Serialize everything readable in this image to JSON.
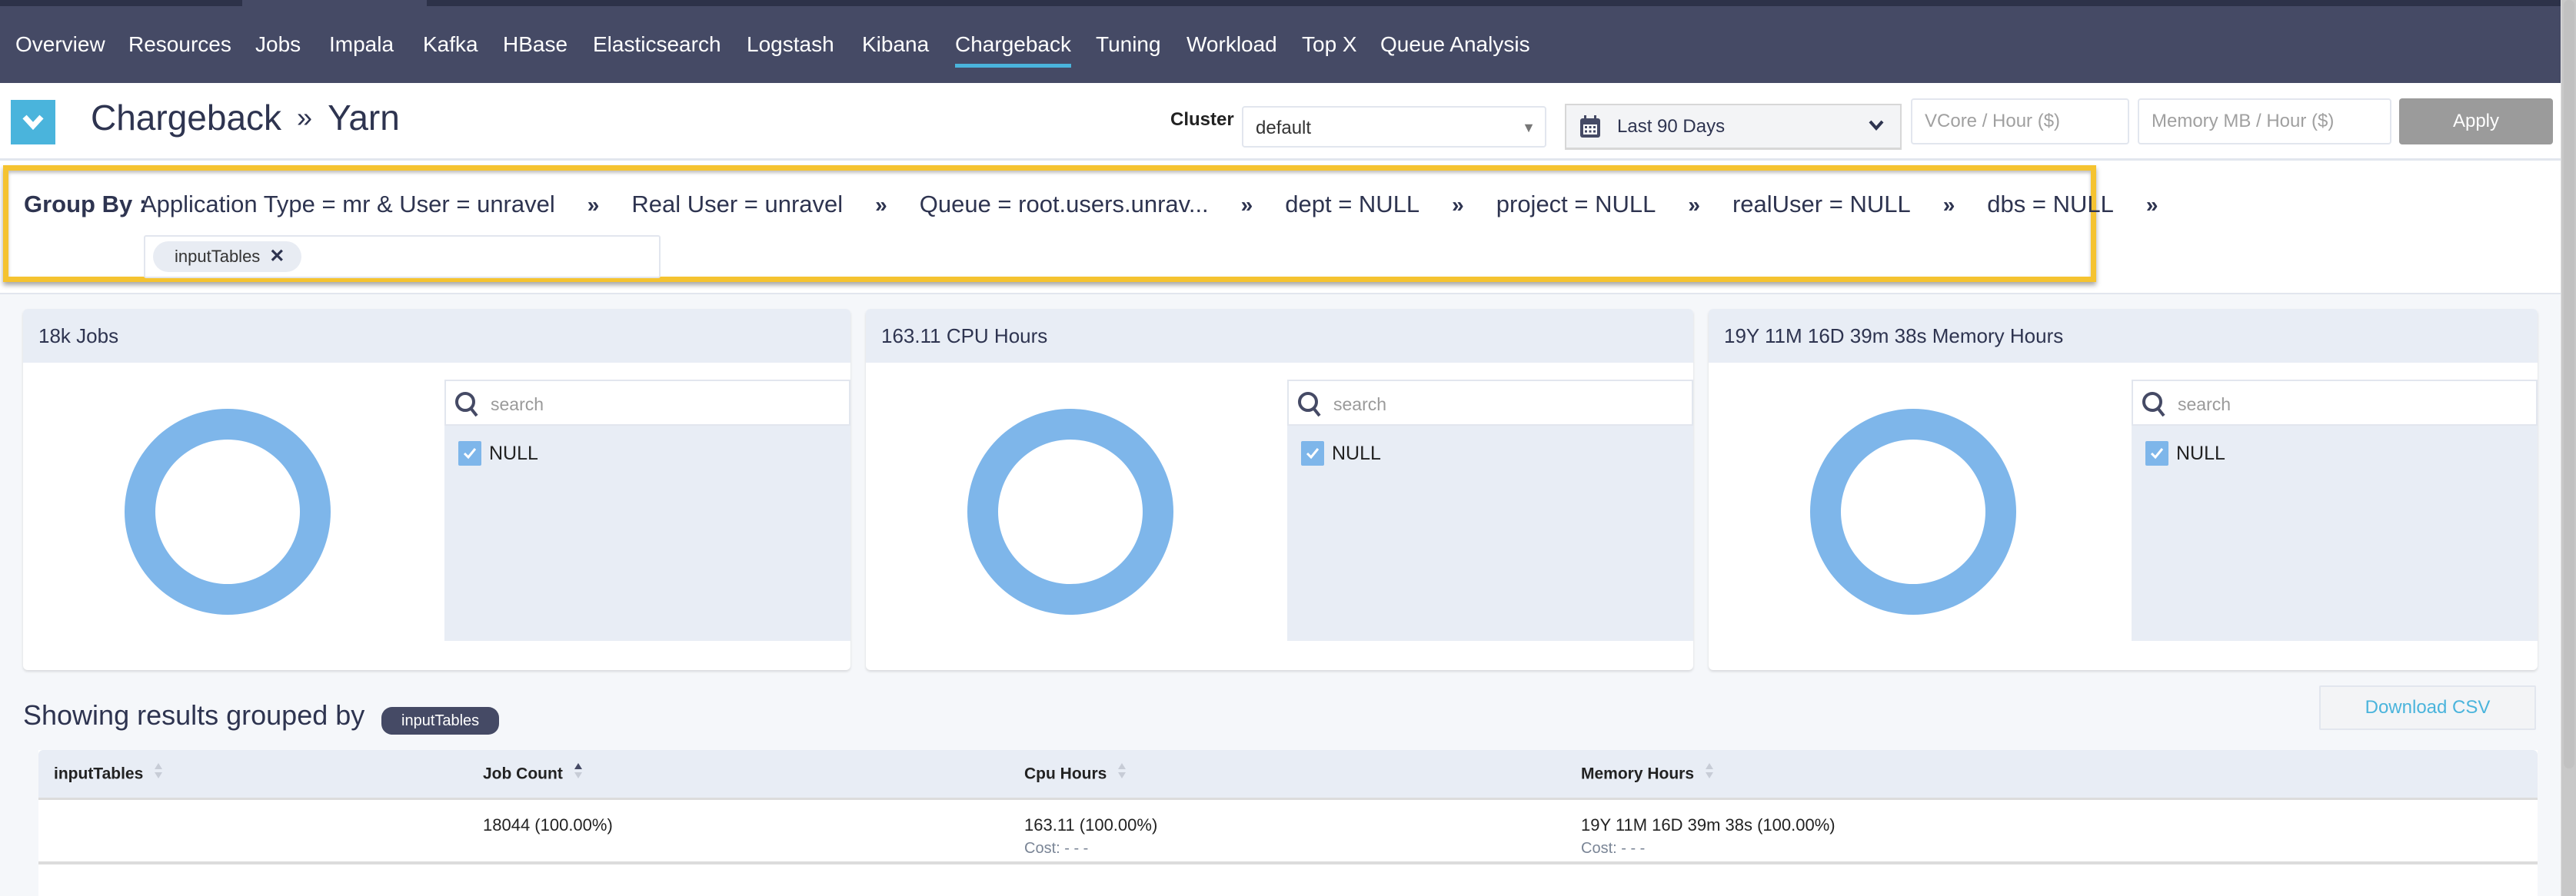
{
  "nav": {
    "items": [
      {
        "label": "Overview",
        "active": false
      },
      {
        "label": "Resources",
        "active": false
      },
      {
        "label": "Jobs",
        "active": false
      },
      {
        "label": "Impala",
        "active": false
      },
      {
        "label": "Kafka",
        "active": false
      },
      {
        "label": "HBase",
        "active": false
      },
      {
        "label": "Elasticsearch",
        "active": false
      },
      {
        "label": "Logstash",
        "active": false
      },
      {
        "label": "Kibana",
        "active": false
      },
      {
        "label": "Chargeback",
        "active": true
      },
      {
        "label": "Tuning",
        "active": false
      },
      {
        "label": "Workload",
        "active": false
      },
      {
        "label": "Top X",
        "active": false
      },
      {
        "label": "Queue Analysis",
        "active": false
      }
    ]
  },
  "header": {
    "logo_icon": "chevron-down-icon",
    "title_part1": "Chargeback",
    "title_sep": "»",
    "title_part2": "Yarn",
    "cluster_label": "Cluster",
    "cluster_value": "default",
    "date_icon": "calendar-icon",
    "date_range": "Last 90 Days",
    "vcore_placeholder": "VCore / Hour ($)",
    "vcore_value": "",
    "memory_placeholder": "Memory MB / Hour ($)",
    "memory_value": "",
    "apply_label": "Apply"
  },
  "group_by": {
    "label": "Group By :",
    "separator": "»",
    "crumbs": [
      "Application Type = mr & User = unravel",
      "Real User = unravel",
      "Queue = root.users.unrav...",
      "dept = NULL",
      "project = NULL",
      "realUser = NULL",
      "dbs = NULL"
    ],
    "selected_tags": [
      "inputTables"
    ],
    "remove_icon": "close-icon",
    "highlight_color": "#f5c330"
  },
  "panels": [
    {
      "title": "18k Jobs",
      "search_placeholder": "search",
      "options": [
        {
          "label": "NULL",
          "checked": true
        }
      ]
    },
    {
      "title": "163.11 CPU Hours",
      "search_placeholder": "search",
      "options": [
        {
          "label": "NULL",
          "checked": true
        }
      ]
    },
    {
      "title": "19Y 11M 16D 39m 38s Memory Hours",
      "search_placeholder": "search",
      "options": [
        {
          "label": "NULL",
          "checked": true
        }
      ]
    }
  ],
  "chart_data": [
    {
      "type": "pie",
      "title": "18k Jobs",
      "donut": true,
      "categories": [
        "NULL"
      ],
      "values": [
        100
      ],
      "colors": [
        "#7eb6ea"
      ]
    },
    {
      "type": "pie",
      "title": "163.11 CPU Hours",
      "donut": true,
      "categories": [
        "NULL"
      ],
      "values": [
        100
      ],
      "colors": [
        "#7eb6ea"
      ]
    },
    {
      "type": "pie",
      "title": "19Y 11M 16D 39m 38s Memory Hours",
      "donut": true,
      "categories": [
        "NULL"
      ],
      "values": [
        100
      ],
      "colors": [
        "#7eb6ea"
      ]
    }
  ],
  "results": {
    "title": "Showing results grouped by",
    "group_chip": "inputTables",
    "download_label": "Download CSV",
    "columns": [
      {
        "label": "inputTables",
        "sort": "none"
      },
      {
        "label": "Job Count",
        "sort": "asc"
      },
      {
        "label": "Cpu Hours",
        "sort": "none"
      },
      {
        "label": "Memory Hours",
        "sort": "none"
      }
    ],
    "rows": [
      {
        "inputTables": "",
        "job_count": "18044 (100.00%)",
        "cpu_hours": "163.11 (100.00%)",
        "cpu_cost": "Cost: - - -",
        "memory_hours": "19Y 11M 16D 39m 38s (100.00%)",
        "memory_cost": "Cost: - - -"
      }
    ]
  },
  "colors": {
    "nav_bg": "#454a65",
    "accent": "#4ab4dc",
    "donut": "#7eb6ea",
    "apply_bg": "#9b9b9b"
  }
}
